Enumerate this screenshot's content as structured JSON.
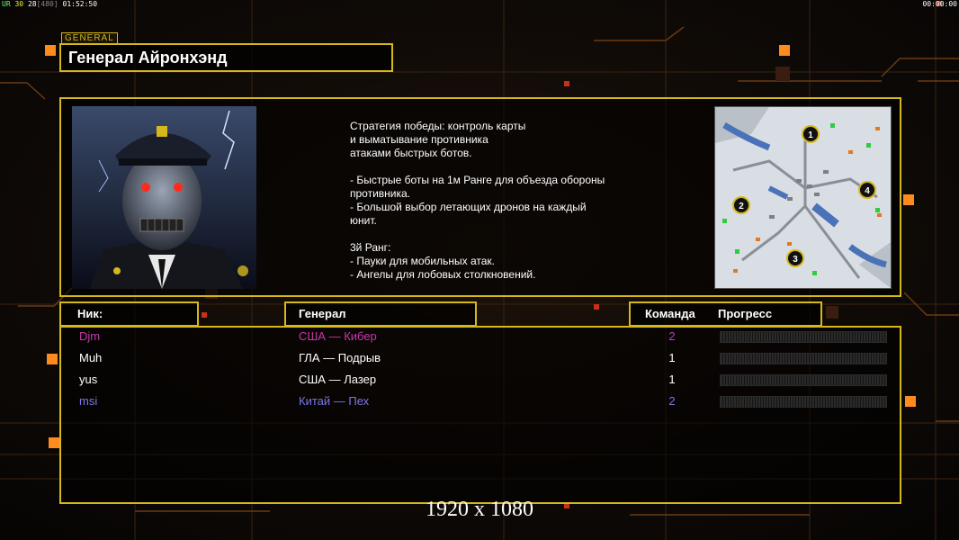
{
  "hud": {
    "top_left": [
      {
        "text": "UR",
        "tone": "g"
      },
      {
        "text": "30",
        "tone": "y"
      },
      {
        "text": "28",
        "tone": "w"
      },
      {
        "text": "[480]",
        "tone": "gr"
      },
      {
        "text": "01:52:50",
        "tone": "w"
      }
    ],
    "top_right": "00:00:00"
  },
  "general_tag": "GENERAL",
  "general_title": "Генерал Айронхэнд",
  "strategy_text": "Стратегия победы: контроль карты\nи выматывание противника\nатаками быстрых ботов.\n\n- Быстрые боты на 1м Ранге для объезда обороны\n противника.\n- Большой выбор летающих дронов на каждый\n юнит.\n\n3й Ранг:\n- Пауки для мобильных атак.\n- Ангелы для лобовых столкновений.",
  "map": {
    "start_positions": [
      "1",
      "2",
      "3",
      "4"
    ]
  },
  "columns": {
    "nick": "Ник:",
    "general": "Генерал",
    "team": "Команда",
    "progress": "Прогресс"
  },
  "players": [
    {
      "nick": "Djm",
      "general": "США — Кибер",
      "team": "2",
      "color": "#c838a8",
      "team_color": "#b040c0",
      "progress": 0
    },
    {
      "nick": "Muh",
      "general": "ГЛА — Подрыв",
      "team": "1",
      "color": "#ffffff",
      "team_color": "#ffffff",
      "progress": 0
    },
    {
      "nick": "yus",
      "general": "США — Лазер",
      "team": "1",
      "color": "#ffffff",
      "team_color": "#ffffff",
      "progress": 0
    },
    {
      "nick": "msi",
      "general": "Китай — Пех",
      "team": "2",
      "color": "#7a78e8",
      "team_color": "#7a78e8",
      "progress": 0
    }
  ],
  "resolution_label": "1920 x 1080",
  "colors": {
    "accent_gold": "#d4b81c",
    "accent_orange": "#ff8a1e"
  }
}
